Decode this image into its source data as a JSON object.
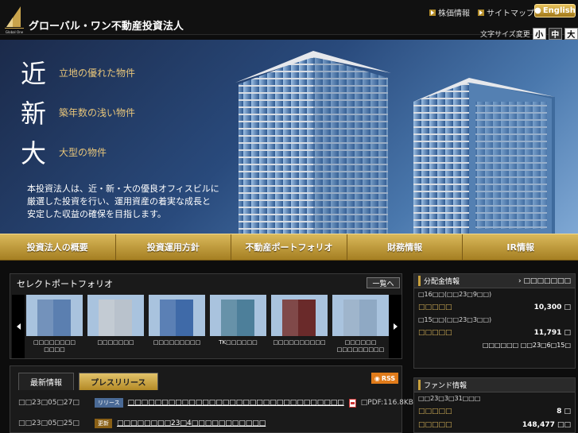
{
  "header": {
    "logo_caption": "Global One",
    "site_title": "グローバル・ワン不動産投資法人",
    "links": [
      "株価情報",
      "サイトマップ"
    ],
    "english_label": "English",
    "font_size_label": "文字サイズ変更",
    "font_sizes": [
      "小",
      "中",
      "大"
    ]
  },
  "hero": {
    "claims": [
      {
        "big": "近",
        "small": "立地の優れた物件"
      },
      {
        "big": "新",
        "small": "築年数の浅い物件"
      },
      {
        "big": "大",
        "small": "大型の物件"
      }
    ],
    "description": [
      "本投資法人は、近・新・大の優良オフィスビルに",
      "厳選した投資を行い、運用資産の着実な成長と",
      "安定した収益の確保を目指します。"
    ]
  },
  "nav": [
    "投資法人の概要",
    "投資運用方針",
    "不動産ポートフォリオ",
    "財務情報",
    "IR情報"
  ],
  "portfolio": {
    "title": "セレクトポートフォリオ",
    "list_button": "一覧へ",
    "items": [
      {
        "caption": "□□□□□□□□\n□□□□",
        "color": "#5b7fb0"
      },
      {
        "caption": "□□□□□□□",
        "color": "#b9c2cc"
      },
      {
        "caption": "□□□□□□□□□",
        "color": "#3f6aa8"
      },
      {
        "caption": "TK□□□□□□",
        "color": "#4d7f9a"
      },
      {
        "caption": "□□□□□□□□□□",
        "color": "#6a2a2a"
      },
      {
        "caption": "□□□□□□\n□□□□□□□□□",
        "color": "#8fa9c4"
      }
    ]
  },
  "news": {
    "tabs": [
      "最新情報",
      "プレスリリース"
    ],
    "rss_label": "RSS",
    "items": [
      {
        "date": "□□23□05□27□",
        "tag": "リリース",
        "tag_type": "release",
        "title": "□□□□□□□□□□□□□□□□□□□□□□□□□□□□□□□□",
        "file": "□PDF:116.8KB□"
      },
      {
        "date": "□□23□05□25□",
        "tag": "更新",
        "tag_type": "update",
        "title": "□□□□□□□□23□4□□□□□□□□□□□",
        "file": ""
      }
    ]
  },
  "distribution": {
    "title": "分配金情報",
    "more": "□□□□□□□",
    "periods": [
      {
        "label": "□16□□(□□23□9□□)",
        "key": "□□□□□",
        "value": "10,300 □"
      },
      {
        "label": "□15□□(□□23□3□□)",
        "key": "□□□□□",
        "value": "11,791 □"
      }
    ],
    "note": "□□□□□□ □□23□6□15□"
  },
  "fund": {
    "title": "ファンド情報",
    "date": "□□23□3□31□□□",
    "rows": [
      {
        "key": "□□□□□",
        "value": "8 □"
      },
      {
        "key": "□□□□□",
        "value": "148,477 □□"
      }
    ]
  }
}
